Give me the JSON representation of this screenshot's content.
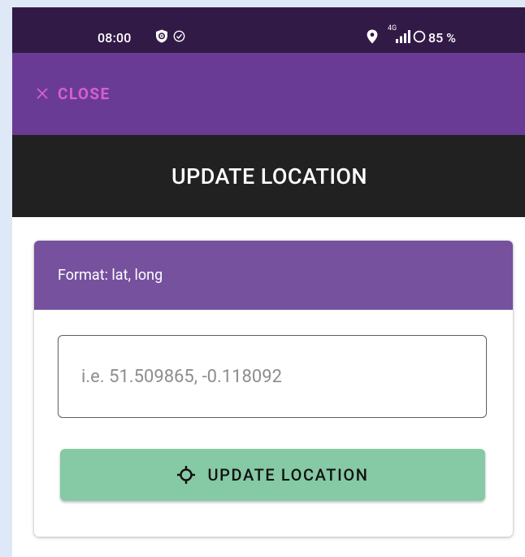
{
  "status_bar": {
    "time": "08:00",
    "network": "4G",
    "battery": "85 %",
    "icons": [
      "shield-icon",
      "check-circle-icon",
      "location-pin-icon",
      "signal-icon",
      "battery-icon"
    ]
  },
  "app_bar": {
    "close_label": "CLOSE",
    "close_icon": "close-icon",
    "background": "#6a3b94",
    "accent": "#d65fcf"
  },
  "title_bar": {
    "title": "UPDATE LOCATION",
    "background": "#212121"
  },
  "location_card": {
    "header": "Format: lat, long",
    "header_background": "#76519e",
    "input": {
      "value": "",
      "placeholder": "i.e. 51.509865, -0.118092"
    },
    "update_button": {
      "label": "UPDATE LOCATION",
      "icon": "crosshair-icon",
      "background": "#86c9a5"
    }
  }
}
